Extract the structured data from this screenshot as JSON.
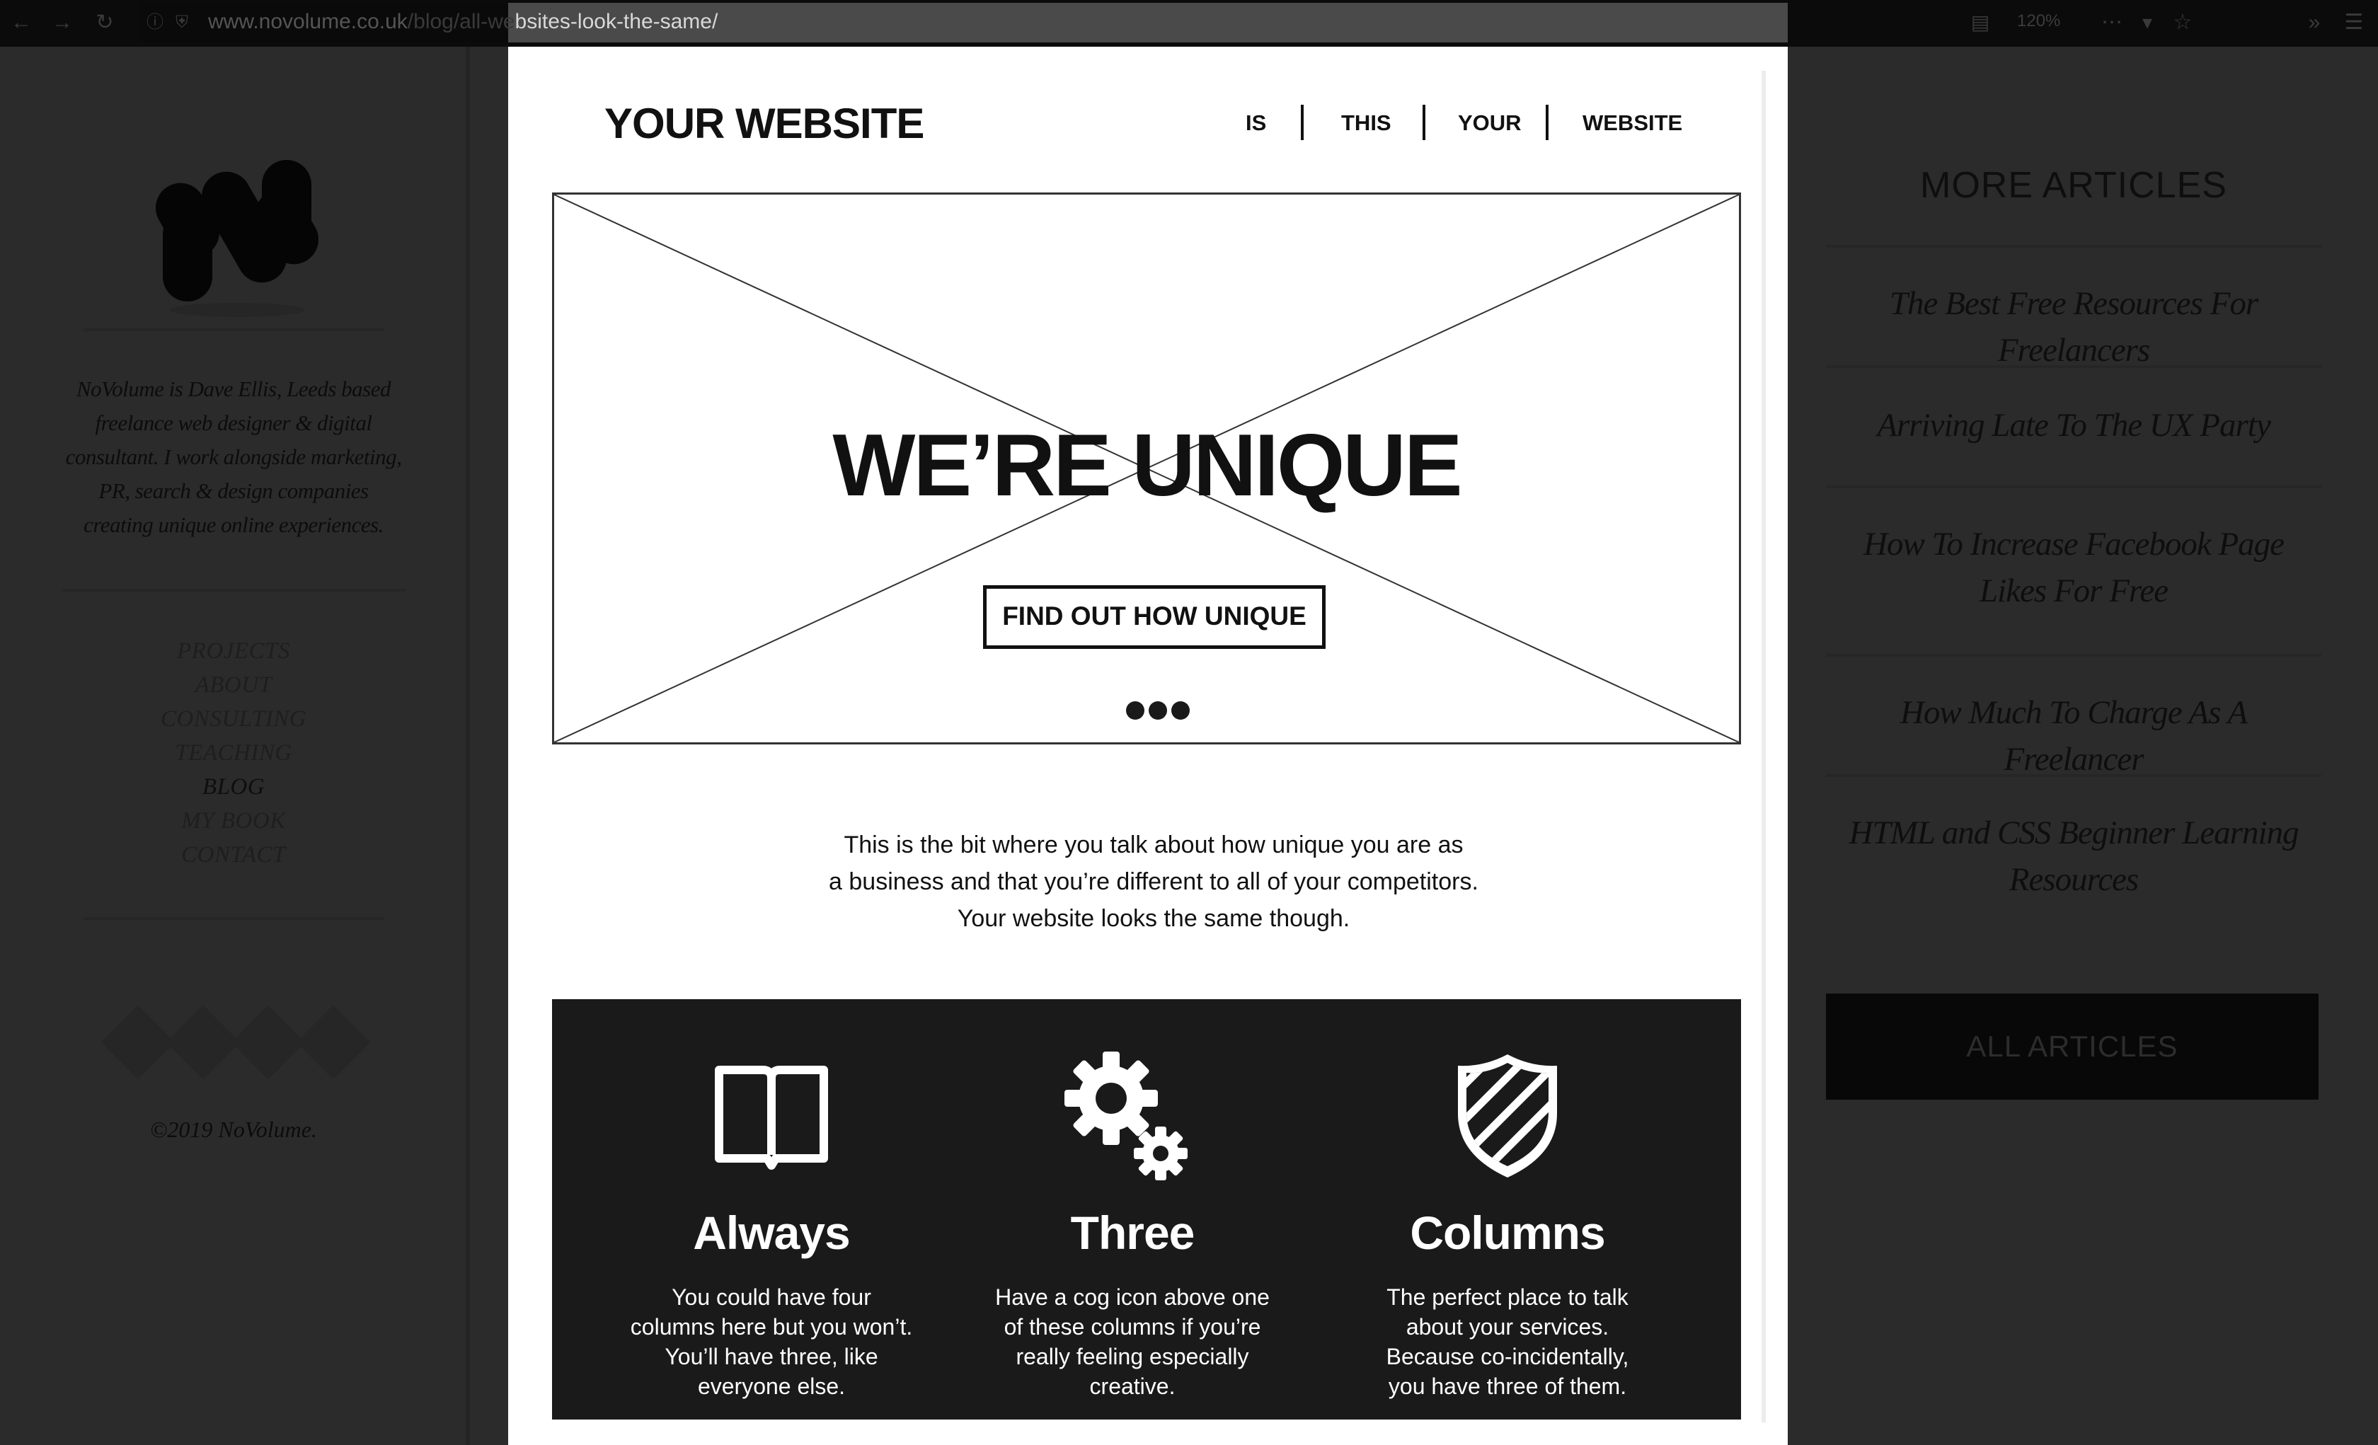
{
  "browser": {
    "url_domain": "www.novolume.co.uk",
    "url_path_dim": "/blog/all-we",
    "url_path_bright": "bsites-look-the-same/",
    "zoom": "120%",
    "icons": [
      "back-icon",
      "forward-icon",
      "reload-icon",
      "info-icon",
      "shield-icon",
      "reader-icon",
      "more-icon",
      "pocket-icon",
      "star-icon",
      "extensions-overflow-icon",
      "menu-icon"
    ]
  },
  "sidebar": {
    "bio": "NoVolume is Dave Ellis, Leeds based freelance web designer & digital consultant. I work alongside marketing, PR, search & design companies creating unique online experiences.",
    "nav": [
      "PROJECTS",
      "ABOUT",
      "CONSULTING",
      "TEACHING",
      "BLOG",
      "MY BOOK",
      "CONTACT"
    ],
    "active": "BLOG",
    "social_icons": [
      "twitter-icon",
      "dribbble-icon",
      "linkedin-icon",
      "rss-icon"
    ],
    "copyright": "©2019 NoVolume."
  },
  "wireframe": {
    "site_title": "YOUR WEBSITE",
    "nav": [
      "IS",
      "THIS",
      "YOUR",
      "WEBSITE"
    ],
    "hero_title": "WE’RE UNIQUE",
    "hero_button": "FIND OUT HOW UNIQUE",
    "slider_dots": 3,
    "intro_lines": [
      "This is the bit where you talk about how unique you are as",
      "a business and that you’re different to all of your competitors.",
      "Your website looks the same though."
    ],
    "features": [
      {
        "icon": "book-icon",
        "title": "Always",
        "text": "You could have four columns here but you won’t. You’ll have three, like everyone else."
      },
      {
        "icon": "cogs-icon",
        "title": "Three",
        "text": "Have a cog icon above one of these columns if you’re really feeling especially creative."
      },
      {
        "icon": "shield-icon",
        "title": "Columns",
        "text": "The perfect place to talk about your services. Because co-incidentally, you have three of them."
      }
    ]
  },
  "more_articles": {
    "title": "MORE ARTICLES",
    "items": [
      "The Best Free Resources For Freelancers",
      "Arriving Late To The UX Party",
      "How To Increase Facebook Page Likes For Free",
      "How Much To Charge As A Freelancer",
      "HTML and CSS Beginner Learning Resources"
    ],
    "button": "ALL ARTICLES"
  }
}
